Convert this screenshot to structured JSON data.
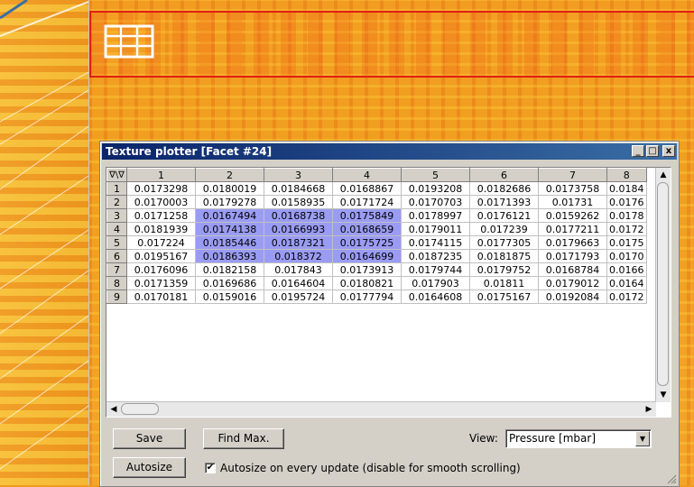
{
  "window": {
    "title": "Texture plotter [Facet #24]",
    "controls": {
      "minimize": "_",
      "maximize": "□",
      "close": "x"
    }
  },
  "grid": {
    "corner_label": "∇\\∇",
    "columns": [
      "1",
      "2",
      "3",
      "4",
      "5",
      "6",
      "7",
      "8"
    ],
    "rows": [
      {
        "label": "1",
        "cells": [
          "0.0173298",
          "0.0180019",
          "0.0184668",
          "0.0168867",
          "0.0193208",
          "0.0182686",
          "0.0173758",
          "0.0184"
        ]
      },
      {
        "label": "2",
        "cells": [
          "0.0170003",
          "0.0179278",
          "0.0158935",
          "0.0171724",
          "0.0170703",
          "0.0171393",
          "0.01731",
          "0.0176"
        ]
      },
      {
        "label": "3",
        "cells": [
          "0.0171258",
          "0.0167494",
          "0.0168738",
          "0.0175849",
          "0.0178997",
          "0.0176121",
          "0.0159262",
          "0.0178"
        ]
      },
      {
        "label": "4",
        "cells": [
          "0.0181939",
          "0.0174138",
          "0.0166993",
          "0.0168659",
          "0.0179011",
          "0.017239",
          "0.0177211",
          "0.0172"
        ]
      },
      {
        "label": "5",
        "cells": [
          "0.017224",
          "0.0185446",
          "0.0187321",
          "0.0175725",
          "0.0174115",
          "0.0177305",
          "0.0179663",
          "0.0175"
        ]
      },
      {
        "label": "6",
        "cells": [
          "0.0195167",
          "0.0186393",
          "0.018372",
          "0.0164699",
          "0.0187235",
          "0.0181875",
          "0.0171793",
          "0.0170"
        ]
      },
      {
        "label": "7",
        "cells": [
          "0.0176096",
          "0.0182158",
          "0.017843",
          "0.0173913",
          "0.0179744",
          "0.0179752",
          "0.0168784",
          "0.0166"
        ]
      },
      {
        "label": "8",
        "cells": [
          "0.0171359",
          "0.0169686",
          "0.0164604",
          "0.0180821",
          "0.017903",
          "0.01811",
          "0.0179012",
          "0.0164"
        ]
      },
      {
        "label": "9",
        "cells": [
          "0.0170181",
          "0.0159016",
          "0.0195724",
          "0.0177794",
          "0.0164608",
          "0.0175167",
          "0.0192084",
          "0.0172"
        ]
      }
    ],
    "selection": {
      "rows": [
        3,
        4,
        5,
        6
      ],
      "cols": [
        2,
        3,
        4
      ]
    }
  },
  "buttons": {
    "save": "Save",
    "find_max": "Find Max.",
    "autosize": "Autosize"
  },
  "view": {
    "label": "View:",
    "selected": "Pressure [mbar]"
  },
  "autosize_option": {
    "checked": true,
    "label": "Autosize on every update (disable for smooth scrolling)"
  },
  "colors": {
    "selection": "#9a9cf4",
    "title_start": "#0a246a",
    "title_end": "#3a6ea5",
    "facet_outline": "#e02010"
  }
}
